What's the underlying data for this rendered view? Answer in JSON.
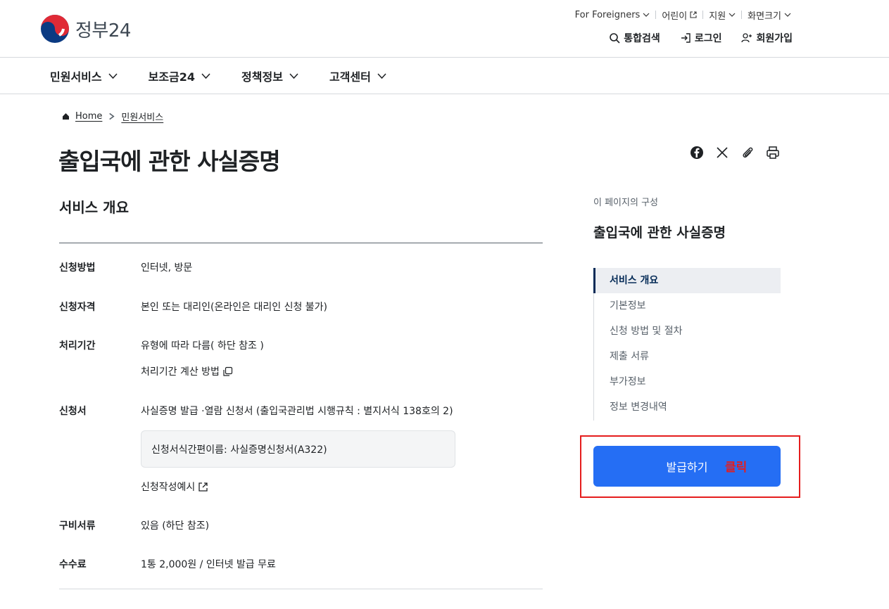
{
  "brand": {
    "name": "정부24"
  },
  "utility": [
    "For Foreigners",
    "어린이",
    "지원",
    "화면크기"
  ],
  "account": {
    "search": "통합검색",
    "login": "로그인",
    "signup": "회원가입"
  },
  "gnb": [
    "민원서비스",
    "보조금24",
    "정책정보",
    "고객센터"
  ],
  "breadcrumb": {
    "home": "Home",
    "current": "민원서비스"
  },
  "page": {
    "title": "출입국에 관한 사실증명"
  },
  "overview": {
    "title": "서비스 개요",
    "rows": [
      {
        "label": "신청방법",
        "value": "인터넷, 방문"
      },
      {
        "label": "신청자격",
        "value": "본인 또는 대리인(온라인은 대리인 신청 불가)"
      },
      {
        "label": "처리기간",
        "value": "유형에 따라 다름( 하단 참조 )",
        "link": "처리기간 계산 방법"
      },
      {
        "label": "신청서",
        "value": "사실증명 발급 ·열람 신청서 (출입국관리법 시행규칙 : 별지서식 138호의 2)",
        "box": "신청서식간편이름: 사실증명신청서(A322)",
        "link": "신청작성예시"
      },
      {
        "label": "구비서류",
        "value": "있음 (하단 참조)"
      },
      {
        "label": "수수료",
        "value": "1통 2,000원 / 인터넷 발급 무료"
      }
    ]
  },
  "toc": {
    "caption": "이 페이지의 구성",
    "title": "출입국에 관한 사실증명",
    "items": [
      "서비스 개요",
      "기본정보",
      "신청 방법 및 절차",
      "제출 서류",
      "부가정보",
      "정보 변경내역"
    ]
  },
  "action": {
    "issue": "발급하기",
    "annotation": "클릭"
  },
  "colors": {
    "primary": "#256ef4",
    "accent_red": "#e51d1d",
    "navy": "#052b57"
  },
  "icons": [
    "search-icon",
    "login-icon",
    "user-plus-icon",
    "chevron-down-icon",
    "home-icon",
    "facebook-icon",
    "x-icon",
    "paperclip-icon",
    "print-icon",
    "copy-icon",
    "external-link-icon"
  ]
}
